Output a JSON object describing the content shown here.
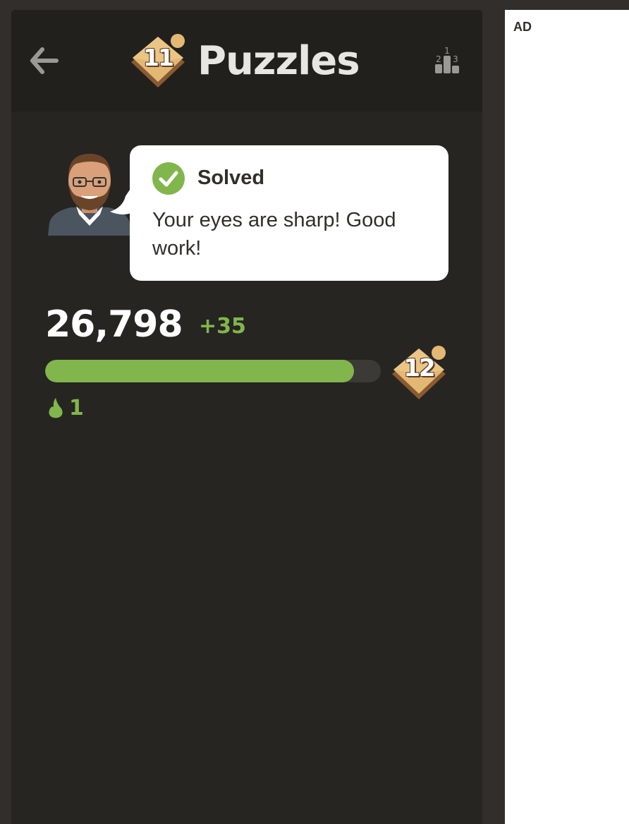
{
  "header": {
    "back_icon": "arrow-left-icon",
    "rating_level": "11",
    "title": "Puzzles",
    "leaderboard_icon": "podium-icon",
    "podium_labels": [
      "2",
      "1",
      "3"
    ]
  },
  "coach": {
    "avatar_icon": "coach-avatar-icon",
    "status_icon": "checkmark-circle-icon",
    "status_label": "Solved",
    "message": "Your eyes are sharp! Good work!"
  },
  "progress": {
    "rating": "26,798",
    "rating_change": "+35",
    "fill_fraction": 0.92,
    "next_level": "12",
    "streak_icon": "flame-icon",
    "streak_count": "1"
  },
  "ad": {
    "label": "AD"
  },
  "colors": {
    "background": "#312e2b",
    "panel": "#262522",
    "header": "#21201d",
    "accent_green": "#81b64c",
    "badge_gold": "#e3b873",
    "badge_brown": "#8a5a33"
  }
}
